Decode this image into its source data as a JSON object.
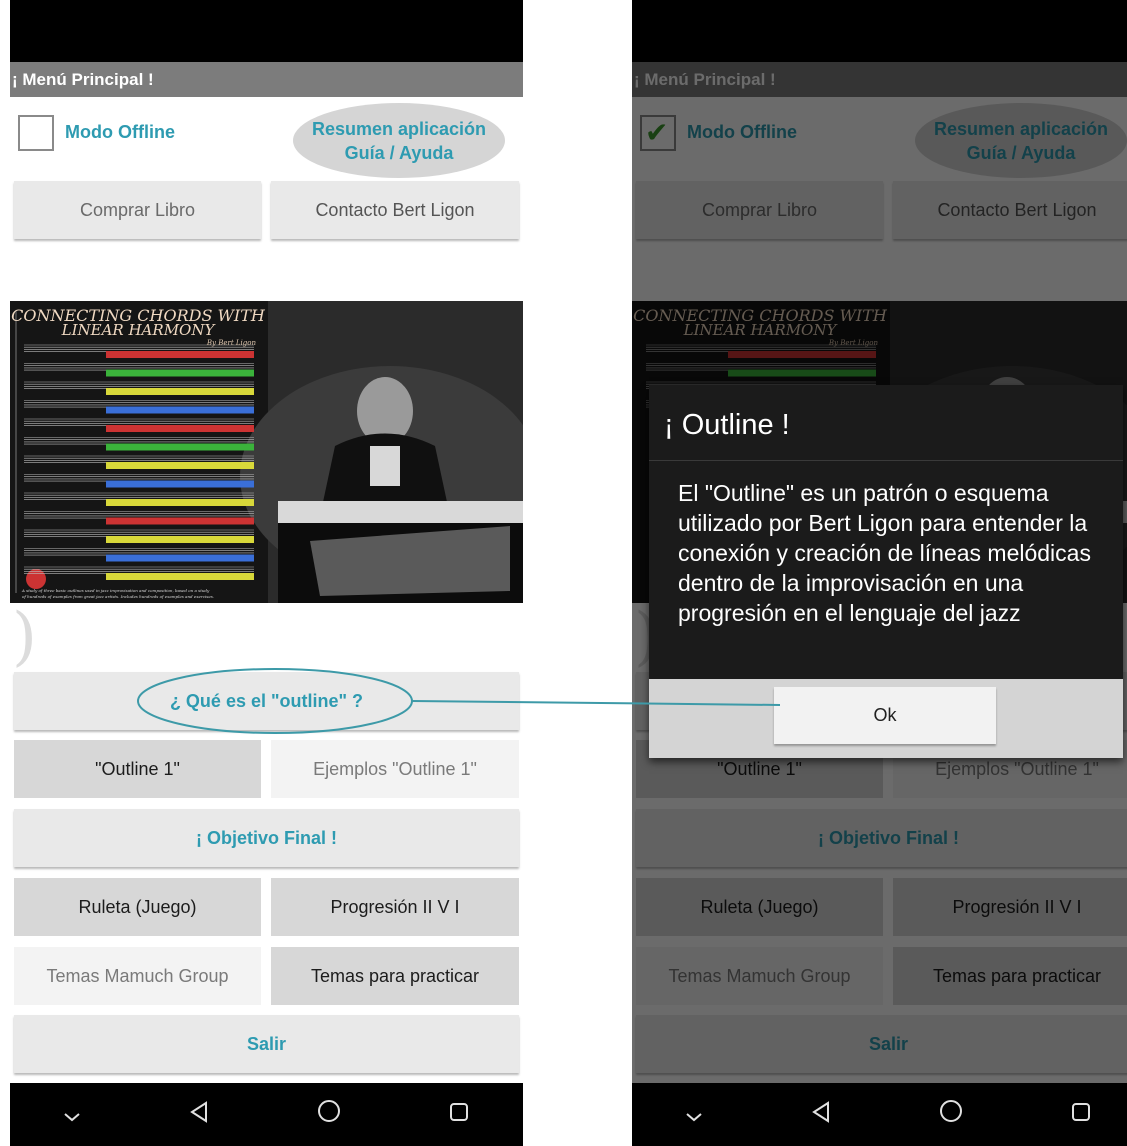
{
  "app_title": "¡ Menú Principal !",
  "offline": {
    "label": "Modo Offline"
  },
  "help": {
    "line1": "Resumen aplicación",
    "line2": "Guía / Ayuda"
  },
  "buttons": {
    "buy_book": "Comprar Libro",
    "contact": "Contacto Bert Ligon",
    "what_outline": "¿ Qué es el \"outline\" ?",
    "outline1": "\"Outline 1\"",
    "examples_outline1": "Ejemplos \"Outline 1\"",
    "final_goal": "¡ Objetivo Final !",
    "roulette": "Ruleta (Juego)",
    "progression": "Progresión II V I",
    "mamuch": "Temas Mamuch Group",
    "practice": "Temas para practicar",
    "exit": "Salir"
  },
  "cover": {
    "title_line1": "CONNECTING CHORDS WITH",
    "title_line2": "LINEAR HARMONY",
    "byline": "By Bert Ligon",
    "blurb_line1": "A study of three basic outlines used in jazz improvisation and composition, based on a study",
    "blurb_line2": "of hundreds of examples from great jazz artists. Includes hundreds of examples and exercises.",
    "bar_colors": [
      "#cc3333",
      "#3bb33b",
      "#d8d83a",
      "#3a6fd8",
      "#cc3333",
      "#3bb33b",
      "#d8d83a",
      "#3a6fd8",
      "#d8d83a",
      "#cc3333",
      "#d8d83a",
      "#3a6fd8",
      "#d8d83a"
    ]
  },
  "dialog": {
    "title": "¡ Outline !",
    "message": "El \"Outline\" es un patrón o esquema utilizado por Bert Ligon para entender la conexión y creación de líneas melódicas dentro de la improvisación en una progresión en el lenguaje del jazz",
    "ok": "Ok"
  },
  "nav_icons": [
    "chevron-down-icon",
    "back-icon",
    "home-icon",
    "recents-icon"
  ],
  "colors": {
    "accent": "#2e9bb1",
    "check": "#3d9a2e",
    "appbar": "#7c7c7c"
  }
}
